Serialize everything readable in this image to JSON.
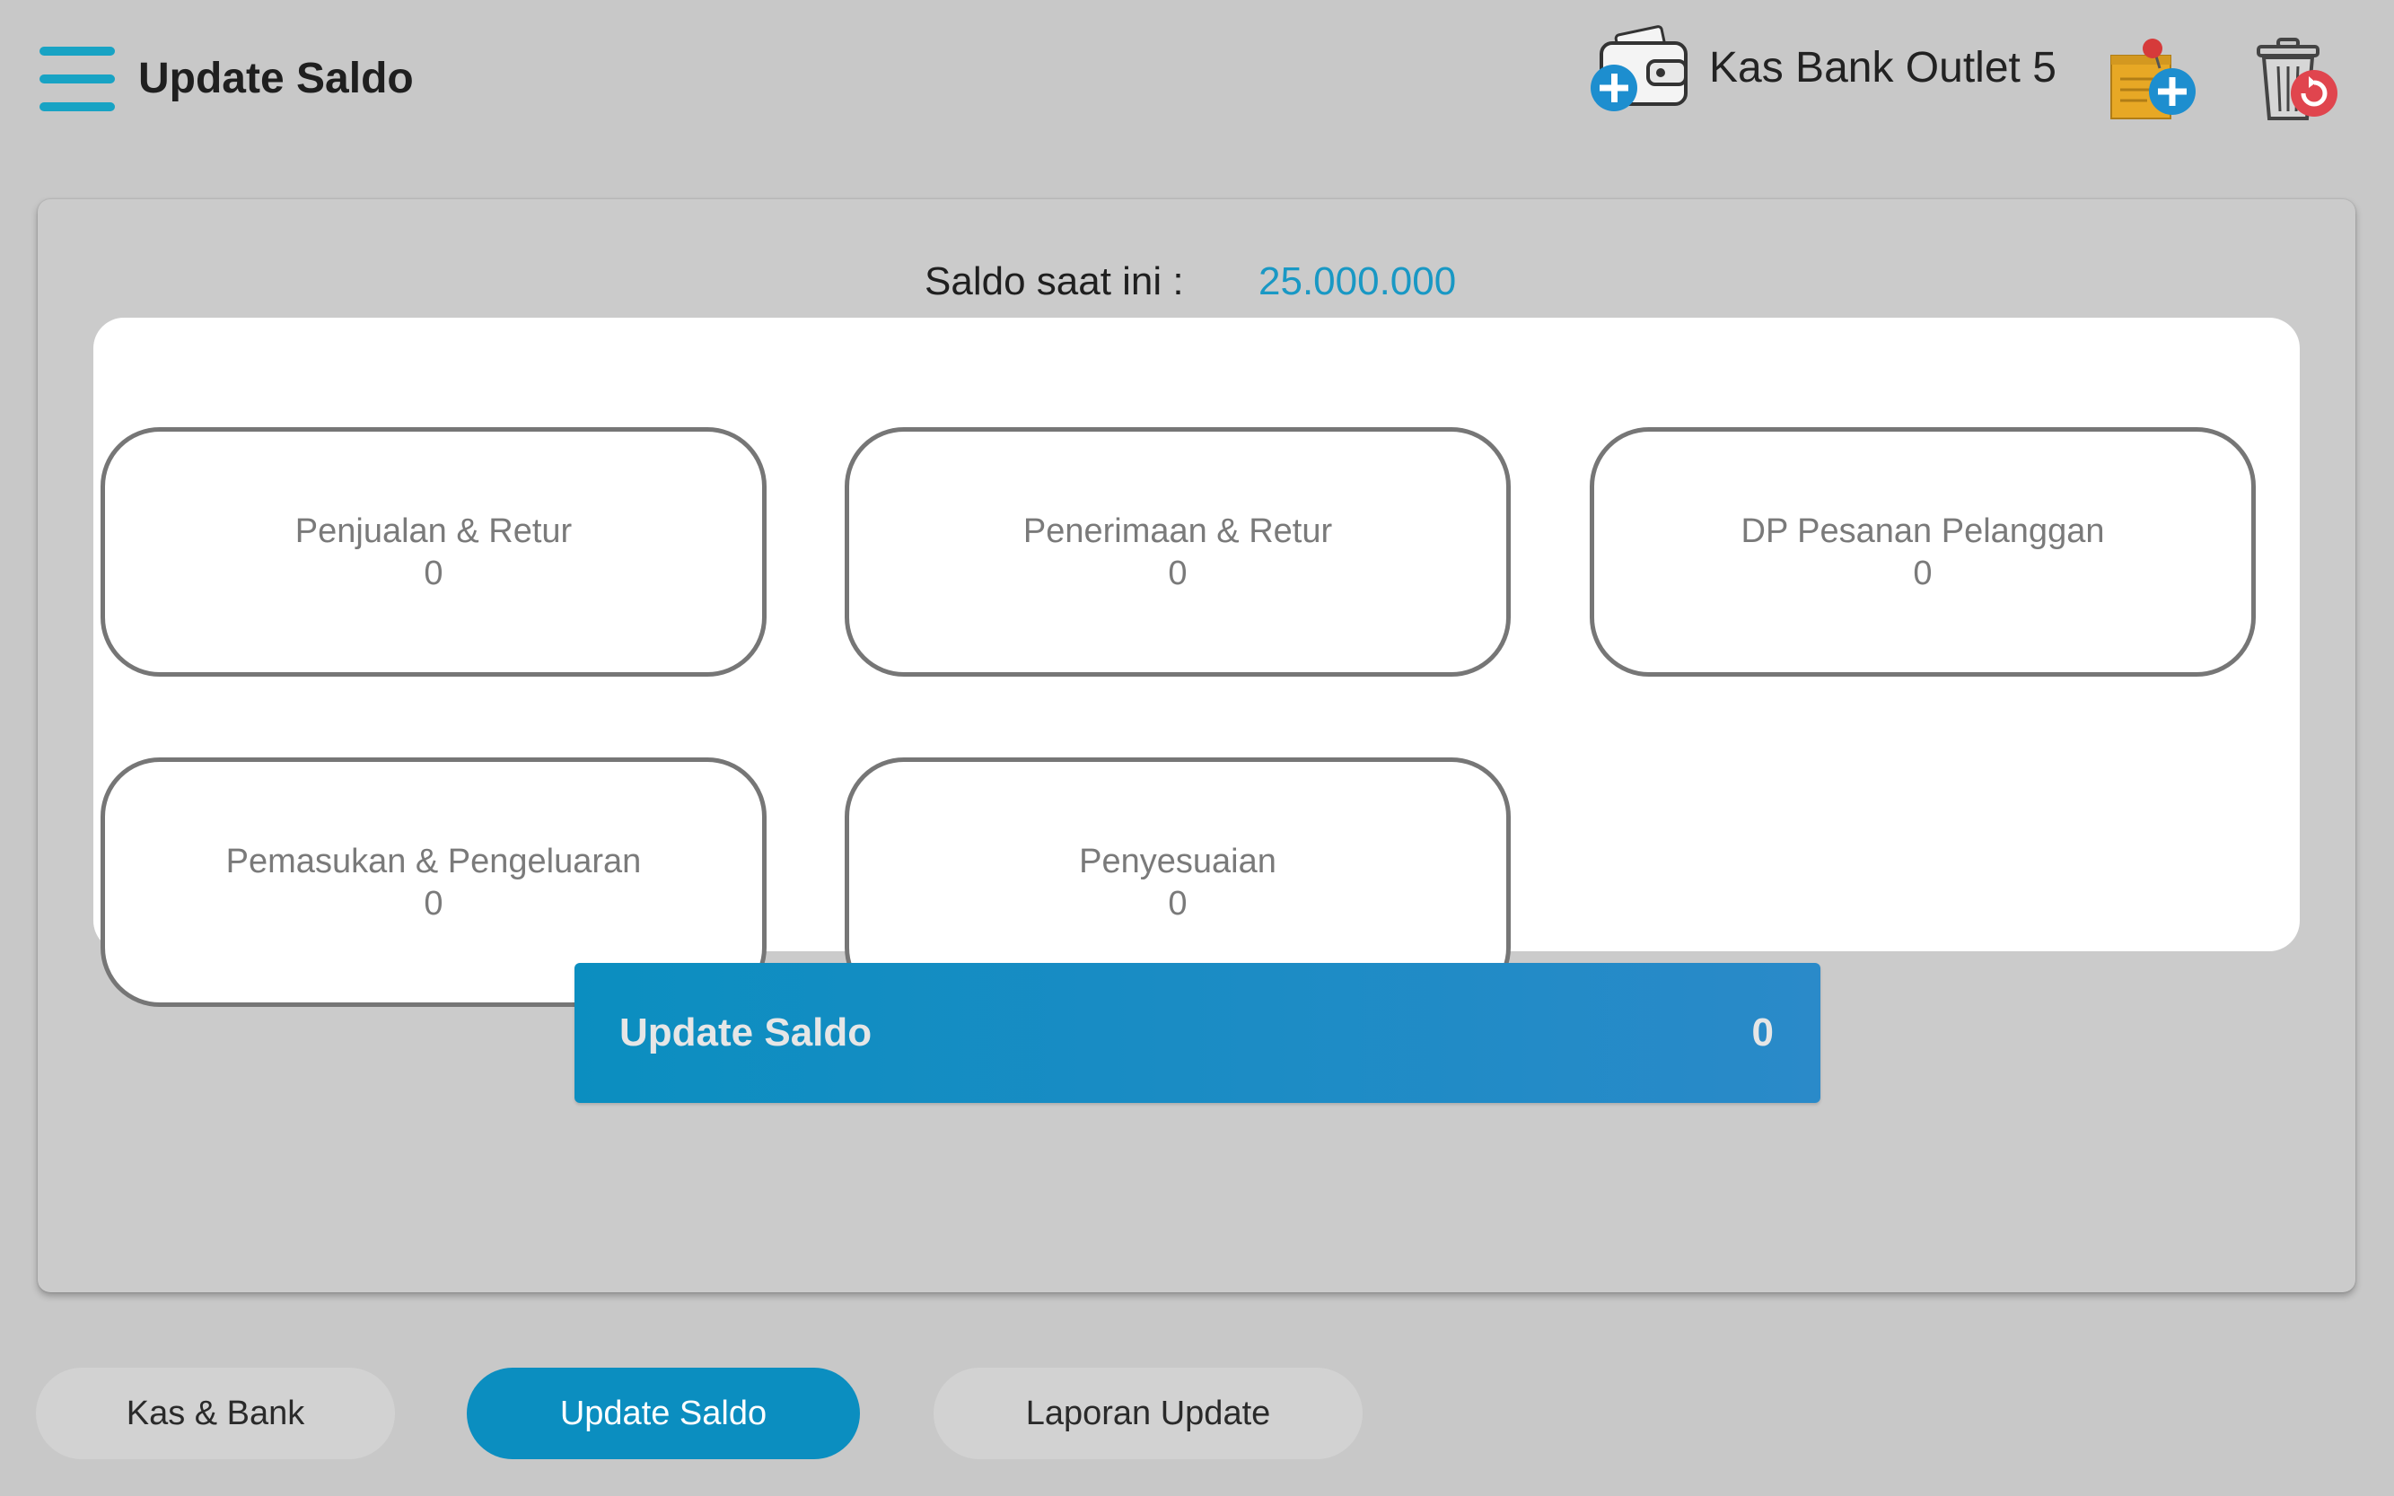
{
  "header": {
    "title": "Update Saldo",
    "outlet_name": "Kas Bank Outlet 5",
    "icons": {
      "menu": "hamburger-menu-icon",
      "wallet": "wallet-add-icon",
      "note": "note-add-icon",
      "trash": "trash-restore-icon"
    }
  },
  "balance": {
    "label": "Saldo saat ini :",
    "value": "25.000.000"
  },
  "tiles": [
    {
      "label": "Penjualan & Retur",
      "value": "0"
    },
    {
      "label": "Penerimaan & Retur",
      "value": "0"
    },
    {
      "label": "DP Pesanan Pelanggan",
      "value": "0"
    },
    {
      "label": "Pemasukan & Pengeluaran",
      "value": "0"
    },
    {
      "label": "Penyesuaian",
      "value": "0"
    }
  ],
  "update_button": {
    "label": "Update Saldo",
    "value": "0"
  },
  "tabs": [
    {
      "label": "Kas & Bank",
      "active": false
    },
    {
      "label": "Update Saldo",
      "active": true
    },
    {
      "label": "Laporan Update",
      "active": false
    }
  ],
  "colors": {
    "accent": "#0b8ec0",
    "balance_value": "#1998c4",
    "background": "#c8c8c8",
    "menu_icon": "#18a3c4"
  }
}
